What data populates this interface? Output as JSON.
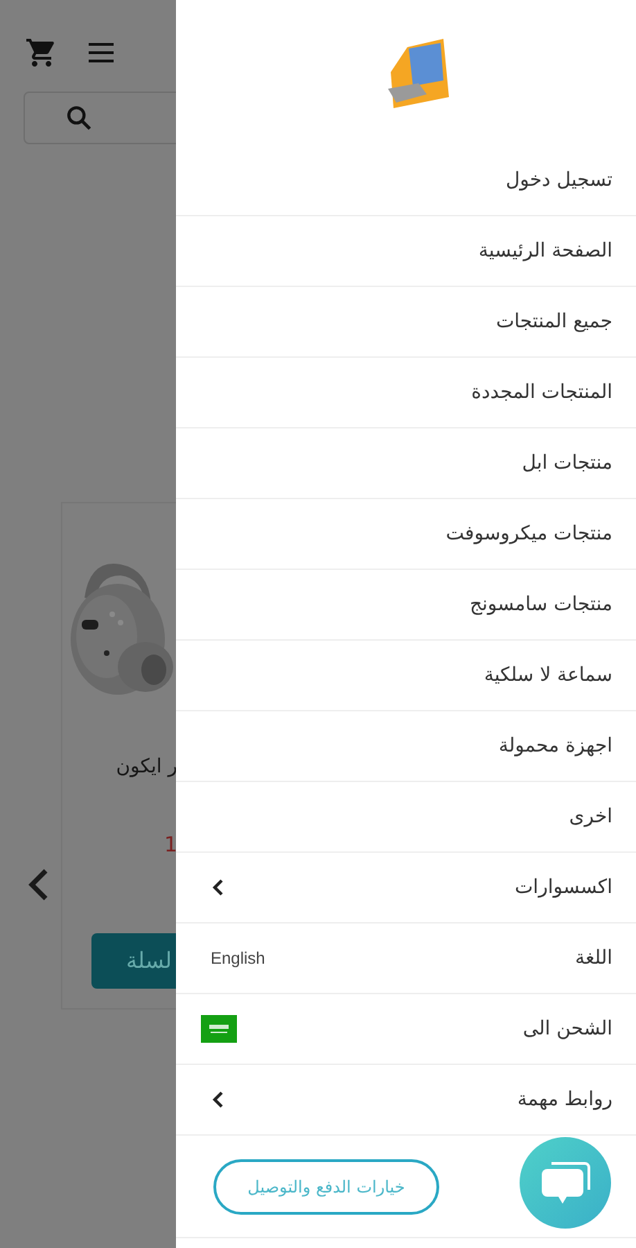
{
  "page": {
    "product": {
      "title": "ر ايكون",
      "price": "1",
      "button": "لسلة"
    }
  },
  "drawer": {
    "items": [
      {
        "kind": "link",
        "label": "تسجيل دخول"
      },
      {
        "kind": "link",
        "label": "الصفحة الرئيسية"
      },
      {
        "kind": "link",
        "label": "جميع المنتجات"
      },
      {
        "kind": "link",
        "label": "المنتجات المجددة"
      },
      {
        "kind": "link",
        "label": "منتجات ابل"
      },
      {
        "kind": "link",
        "label": "منتجات ميكروسوفت"
      },
      {
        "kind": "link",
        "label": "منتجات سامسونج"
      },
      {
        "kind": "link",
        "label": "سماعة لا سلكية"
      },
      {
        "kind": "link",
        "label": "اجهزة محمولة"
      },
      {
        "kind": "link",
        "label": "اخرى"
      },
      {
        "kind": "submenu",
        "label": "اكسسوارات",
        "expanded": false
      },
      {
        "kind": "language",
        "label": "اللغة",
        "value": "English"
      },
      {
        "kind": "shipping",
        "label": "الشحن الى"
      },
      {
        "kind": "submenu",
        "label": "روابط مهمة",
        "expanded": false
      }
    ],
    "footer_button": "خيارات الدفع والتوصيل"
  }
}
